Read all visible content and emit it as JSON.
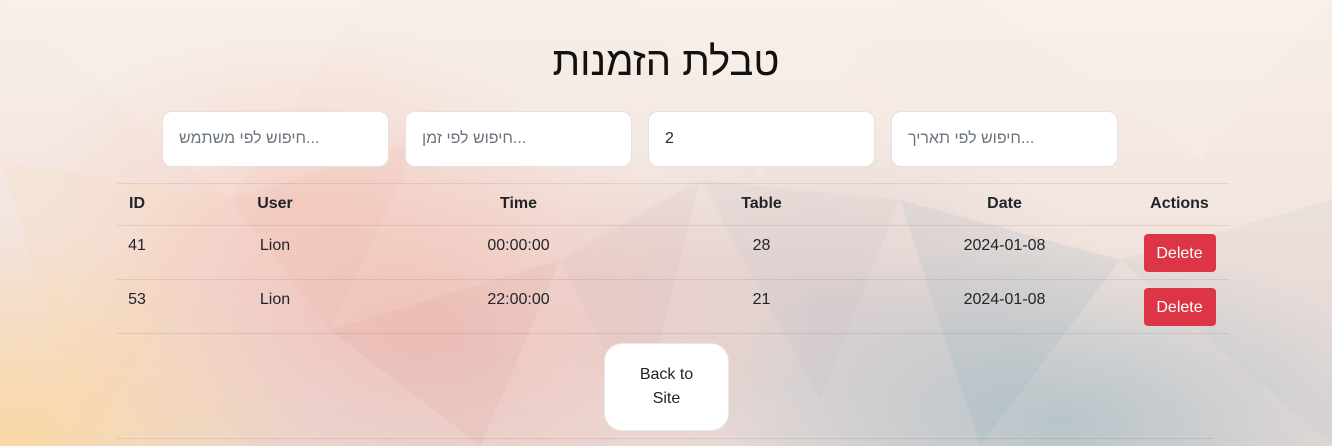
{
  "page": {
    "title": "טבלת הזמנות"
  },
  "filters": {
    "user_placeholder": "...חיפוש לפי משתמש",
    "time_placeholder": "...חיפוש לפי זמן",
    "table_value": "2",
    "date_placeholder": "...חיפוש לפי תאריך"
  },
  "table": {
    "headers": {
      "id": "ID",
      "user": "User",
      "time": "Time",
      "table": "Table",
      "date": "Date",
      "actions": "Actions"
    },
    "rows": [
      {
        "id": "41",
        "user": "Lion",
        "time": "00:00:00",
        "table": "28",
        "date": "2024-01-08",
        "action": "Delete"
      },
      {
        "id": "53",
        "user": "Lion",
        "time": "22:00:00",
        "table": "21",
        "date": "2024-01-08",
        "action": "Delete"
      }
    ]
  },
  "back_button": {
    "label": "Back to Site"
  },
  "colors": {
    "delete": "#dc3545",
    "text": "#212529"
  }
}
